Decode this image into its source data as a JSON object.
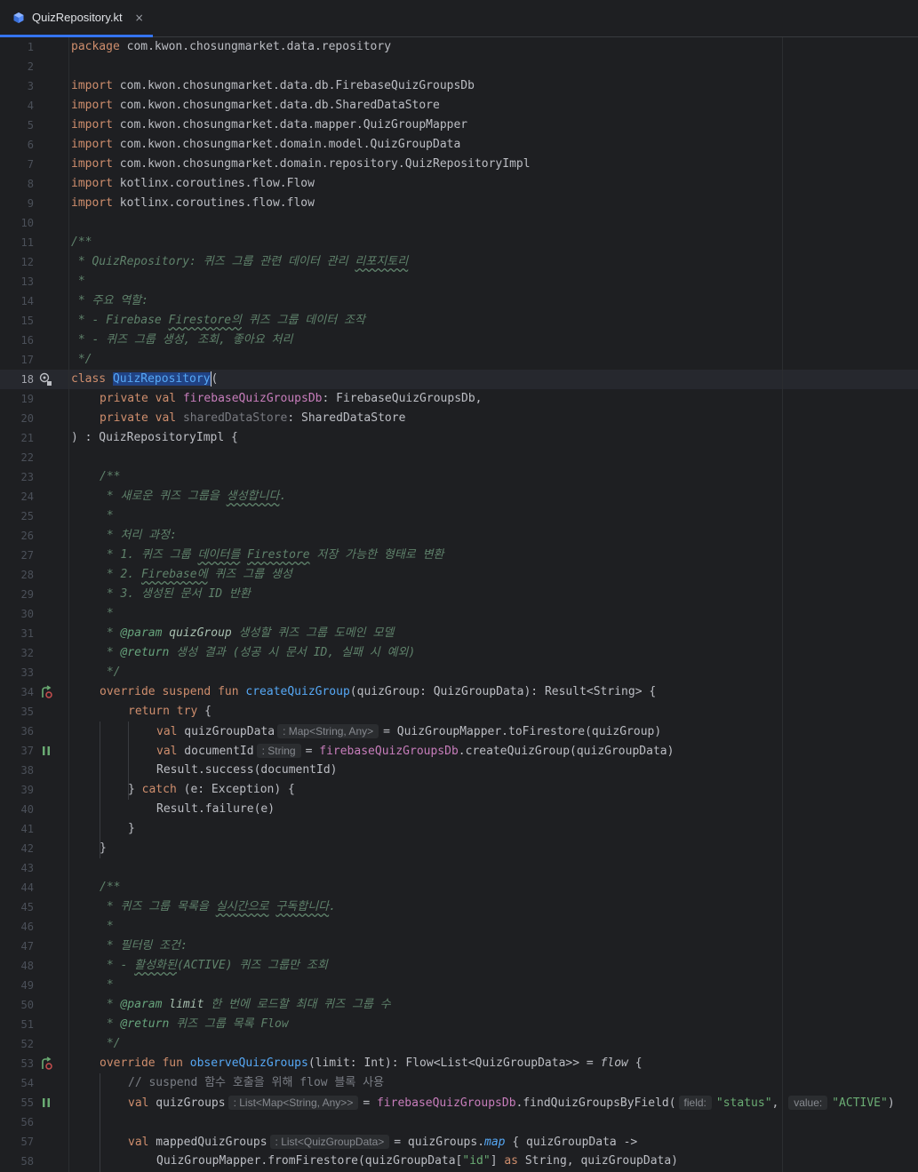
{
  "tab": {
    "filename": "QuizRepository.kt",
    "close_glyph": "×"
  },
  "hints": {
    "l36": ": Map<String, Any>",
    "l37": ": String",
    "l55a": ": List<Map<String, Any>>",
    "l55b": "field:",
    "l55c": "value:",
    "l57": ": List<QuizGroupData>"
  },
  "lines": [
    {
      "n": "1"
    },
    {
      "n": "2"
    },
    {
      "n": "3"
    },
    {
      "n": "4"
    },
    {
      "n": "5"
    },
    {
      "n": "6"
    },
    {
      "n": "7"
    },
    {
      "n": "8"
    },
    {
      "n": "9"
    },
    {
      "n": "10"
    },
    {
      "n": "11"
    },
    {
      "n": "12"
    },
    {
      "n": "13"
    },
    {
      "n": "14"
    },
    {
      "n": "15"
    },
    {
      "n": "16"
    },
    {
      "n": "17"
    },
    {
      "n": "18"
    },
    {
      "n": "19"
    },
    {
      "n": "20"
    },
    {
      "n": "21"
    },
    {
      "n": "22"
    },
    {
      "n": "23"
    },
    {
      "n": "24"
    },
    {
      "n": "25"
    },
    {
      "n": "26"
    },
    {
      "n": "27"
    },
    {
      "n": "28"
    },
    {
      "n": "29"
    },
    {
      "n": "30"
    },
    {
      "n": "31"
    },
    {
      "n": "32"
    },
    {
      "n": "33"
    },
    {
      "n": "34"
    },
    {
      "n": "35"
    },
    {
      "n": "36"
    },
    {
      "n": "37"
    },
    {
      "n": "38"
    },
    {
      "n": "39"
    },
    {
      "n": "40"
    },
    {
      "n": "41"
    },
    {
      "n": "42"
    },
    {
      "n": "43"
    },
    {
      "n": "44"
    },
    {
      "n": "45"
    },
    {
      "n": "46"
    },
    {
      "n": "47"
    },
    {
      "n": "48"
    },
    {
      "n": "49"
    },
    {
      "n": "50"
    },
    {
      "n": "51"
    },
    {
      "n": "52"
    },
    {
      "n": "53"
    },
    {
      "n": "54"
    },
    {
      "n": "55"
    },
    {
      "n": "56"
    },
    {
      "n": "57"
    },
    {
      "n": "58"
    }
  ],
  "tok": {
    "package": "package",
    "import": "import",
    "class": "class",
    "private": "private",
    "val": "val",
    "override": "override",
    "suspend": "suspend",
    "fun": "fun",
    "return": "return",
    "try": "try",
    "catch": "catch",
    "as": "as",
    "l1": " com.kwon.chosungmarket.data.repository",
    "l3": " com.kwon.chosungmarket.data.db.FirebaseQuizGroupsDb",
    "l4": " com.kwon.chosungmarket.data.db.SharedDataStore",
    "l5": " com.kwon.chosungmarket.data.mapper.QuizGroupMapper",
    "l6": " com.kwon.chosungmarket.domain.model.QuizGroupData",
    "l7": " com.kwon.chosungmarket.domain.repository.QuizRepositoryImpl",
    "l8": " kotlinx.coroutines.flow.Flow",
    "l9": " kotlinx.coroutines.flow.flow",
    "l11": "/**",
    "l12a": " * QuizRepository: 퀴즈 그룹 관련 데이터 관리 ",
    "l12b": "리포지토리",
    "l13": " *",
    "l14": " * 주요 역할:",
    "l15a": " * - Firebase ",
    "l15b": "Firestore의",
    "l15c": " 퀴즈 그룹 데이터 조작",
    "l16": " * - 퀴즈 그룹 생성, 조회, 좋아요 처리",
    "l17": " */",
    "l18name": "QuizRepository",
    "l18paren": "(",
    "l19prop": "firebaseQuizGroupsDb",
    "l19rest": ": FirebaseQuizGroupsDb,",
    "l20prop": "sharedDataStore",
    "l20rest": ": SharedDataStore",
    "l21": ") : QuizRepositoryImpl {",
    "l23": "/**",
    "l24a": " * 새로운 퀴즈 그룹을 ",
    "l24b": "생성합니다",
    "l24c": ".",
    "l25": " *",
    "l26": " * 처리 과정:",
    "l27a": " * 1. 퀴즈 그룹 ",
    "l27b": "데이터를",
    "l27c": " ",
    "l27d": "Firestore",
    "l27e": " 저장 가능한 형태로 변환",
    "l28a": " * 2. ",
    "l28b": "Firebase에",
    "l28c": " 퀴즈 그룹 생성",
    "l29": " * 3. 생성된 문서 ID 반환",
    "l30": " *",
    "l31a": " * ",
    "l31tag": "@param",
    "l31p": " quizGroup",
    "l31b": " 생성할 퀴즈 그룹 도메인 모델",
    "l32a": " * ",
    "l32tag": "@return",
    "l32b": " 생성 결과 (성공 시 문서 ID, 실패 시 예외)",
    "l33": " */",
    "l34fn": "createQuizGroup",
    "l34rest": "(quizGroup: QuizGroupData): Result<String> {",
    "l35rest": " {",
    "l36a": " quizGroupData",
    "l36b": "= QuizGroupMapper.toFirestore(quizGroup)",
    "l37a": " documentId",
    "l37b": "= ",
    "l37prop": "firebaseQuizGroupsDb",
    "l37c": ".createQuizGroup(quizGroupData)",
    "l38": "Result.success(documentId)",
    "l39a": "} ",
    "l39b": " (e: Exception) {",
    "l40": "Result.failure(e)",
    "l41": "}",
    "l42": "}",
    "l44": "/**",
    "l45a": " * 퀴즈 그룹 목록을 ",
    "l45b": "실시간으로",
    "l45c": " ",
    "l45d": "구독합니다",
    "l45e": ".",
    "l46": " *",
    "l47": " * 필터링 조건:",
    "l48a": " * - ",
    "l48b": "활성화된",
    "l48c": "(ACTIVE) 퀴즈 그룹만 조회",
    "l49": " *",
    "l50a": " * ",
    "l50tag": "@param",
    "l50p": " limit",
    "l50b": " 한 번에 로드할 최대 퀴즈 그룹 수",
    "l51a": " * ",
    "l51tag": "@return",
    "l51b": " 퀴즈 그룹 목록 Flow",
    "l52": " */",
    "l53fn": "observeQuizGroups",
    "l53rest": "(limit: Int): Flow<List<QuizGroupData>> = ",
    "l53flow": "flow",
    "l53end": " {",
    "l54": "// suspend 함수 호출을 위해 flow 블록 사용",
    "l55a": " quizGroups",
    "l55b": "= ",
    "l55prop": "firebaseQuizGroupsDb",
    "l55c": ".findQuizGroupsByField(",
    "l55s1": "\"status\"",
    "l55comma": ", ",
    "l55s2": "\"ACTIVE\"",
    "l55end": ")",
    "l57a": " mappedQuizGroups",
    "l57b": "= quizGroups.",
    "l57map": "map",
    "l57c": " { quizGroupData ->",
    "l58a": "QuizGroupMapper.fromFirestore(quizGroupData[",
    "l58s": "\"id\"",
    "l58b": "] ",
    "l58c": " String, quizGroupData)"
  }
}
